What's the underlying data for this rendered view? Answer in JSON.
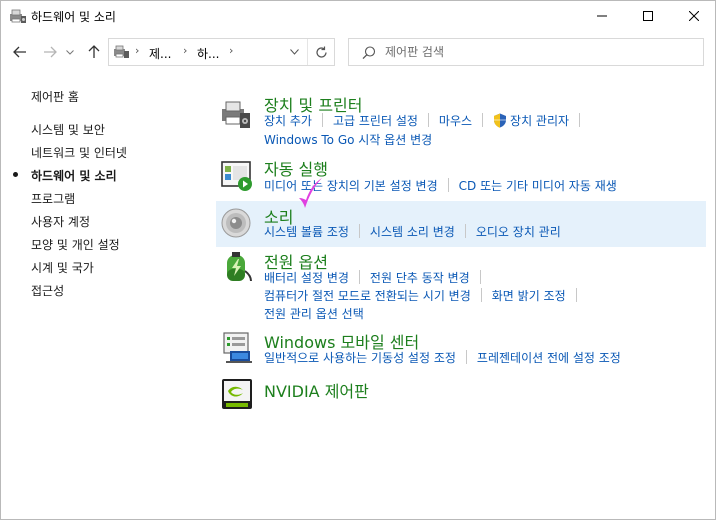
{
  "window": {
    "title": "하드웨어 및 소리"
  },
  "address": {
    "crumbs": [
      "제...",
      "하..."
    ],
    "separator": "›"
  },
  "search": {
    "placeholder": "제어판 검색"
  },
  "sidebar": {
    "items": [
      {
        "label": "제어판 홈"
      },
      {
        "label": "시스템 및 보안"
      },
      {
        "label": "네트워크 및 인터넷"
      },
      {
        "label": "하드웨어 및 소리",
        "current": true
      },
      {
        "label": "프로그램"
      },
      {
        "label": "사용자 계정"
      },
      {
        "label": "모양 및 개인 설정"
      },
      {
        "label": "시계 및 국가"
      },
      {
        "label": "접근성"
      }
    ]
  },
  "categories": [
    {
      "title": "장치 및 프린터",
      "icon": "printer-icon",
      "rows": [
        [
          "장치 추가",
          "고급 프린터 설정",
          "마우스",
          "장치 관리자"
        ],
        [
          "Windows To Go 시작 옵션 변경"
        ]
      ]
    },
    {
      "title": "자동 실행",
      "icon": "autoplay-icon",
      "rows": [
        [
          "미디어 또는 장치의 기본 설정 변경",
          "CD 또는 기타 미디어 자동 재생"
        ]
      ]
    },
    {
      "title": "소리",
      "icon": "speaker-icon",
      "rows": [
        [
          "시스템 볼륨 조정",
          "시스템 소리 변경",
          "오디오 장치 관리"
        ]
      ]
    },
    {
      "title": "전원 옵션",
      "icon": "battery-icon",
      "rows": [
        [
          "배터리 설정 변경",
          "전원 단추 동작 변경"
        ],
        [
          "컴퓨터가 절전 모드로 전환되는 시기 변경",
          "화면 밝기 조정"
        ],
        [
          "전원 관리 옵션 선택"
        ]
      ]
    },
    {
      "title": "Windows 모바일 센터",
      "icon": "mobility-center-icon",
      "rows": [
        [
          "일반적으로 사용하는 기동성 설정 조정",
          "프레젠테이션 전에 설정 조정"
        ]
      ]
    },
    {
      "title": "NVIDIA 제어판",
      "icon": "nvidia-icon",
      "rows": []
    }
  ],
  "colors": {
    "category_title": "#1d7f1d",
    "task_link": "#0a58b5",
    "highlight_bg": "#e5f1fb",
    "annotation_mark": "#e040e0"
  }
}
